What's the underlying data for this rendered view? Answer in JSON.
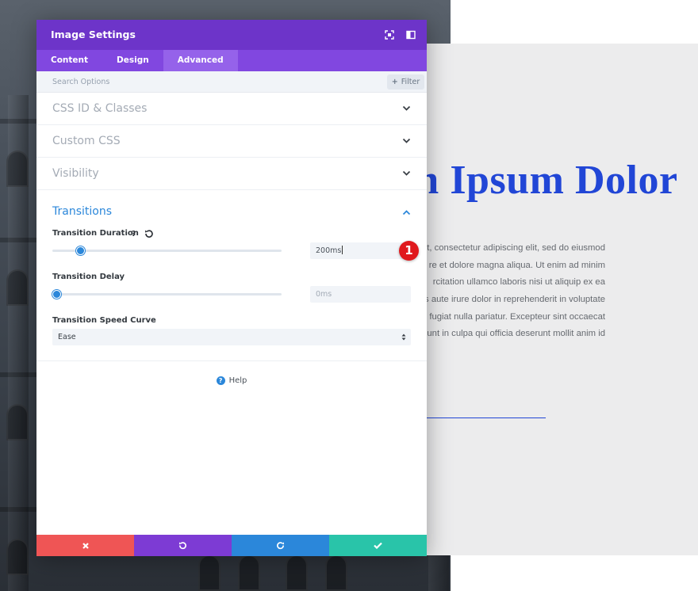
{
  "background": {
    "heading": "m Ipsum Dolor",
    "body_lines": [
      "et, consectetur adipiscing elit, sed do eiusmod",
      "re et dolore magna aliqua. Ut enim ad minim",
      "rcitation ullamco laboris nisi ut aliquip ex ea",
      "s aute irure dolor in reprehenderit in voluptate",
      "fugiat nulla pariatur. Excepteur sint occaecat",
      "unt in culpa qui officia deserunt mollit anim id"
    ],
    "accent_color": "#2146d6"
  },
  "modal": {
    "title": "Image Settings",
    "header_icons": [
      "expand-icon",
      "split-view-icon"
    ],
    "tabs": [
      {
        "label": "Content",
        "active": false
      },
      {
        "label": "Design",
        "active": false
      },
      {
        "label": "Advanced",
        "active": true
      }
    ],
    "search": {
      "placeholder": "Search Options",
      "filter_label": "Filter"
    },
    "sections": [
      {
        "title": "CSS ID & Classes",
        "expanded": false
      },
      {
        "title": "Custom CSS",
        "expanded": false
      },
      {
        "title": "Visibility",
        "expanded": false
      }
    ],
    "transitions": {
      "title": "Transitions",
      "expanded": true,
      "duration": {
        "label": "Transition Duration",
        "help": "?",
        "value": "200ms",
        "slider_fraction": 0.12
      },
      "delay": {
        "label": "Transition Delay",
        "value": "",
        "placeholder": "0ms",
        "slider_fraction": 0.0
      },
      "speed_curve": {
        "label": "Transition Speed Curve",
        "value": "Ease"
      }
    },
    "help_label": "Help",
    "footer": [
      "discard",
      "undo",
      "redo",
      "save"
    ],
    "colors": {
      "header": "#6d34c9",
      "tabs": "#8147e0",
      "active_link": "#2b87da",
      "discard": "#ef5555",
      "undo": "#7d3bd4",
      "redo": "#2b87da",
      "save": "#29c4a9"
    }
  },
  "annotation_badge": "1"
}
